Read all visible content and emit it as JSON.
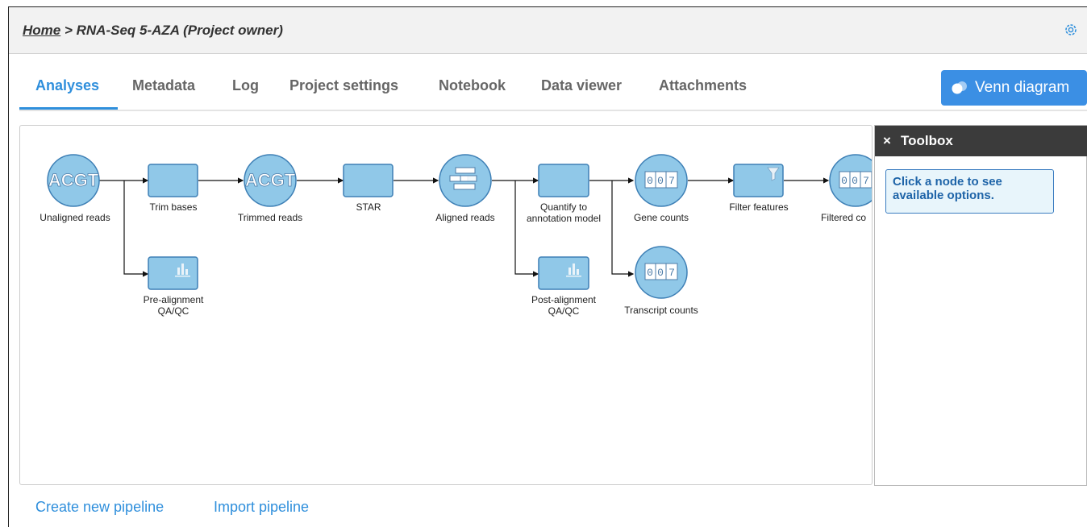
{
  "breadcrumb": {
    "home": "Home",
    "rest": " > RNA-Seq 5-AZA (Project owner)"
  },
  "tabs": [
    "Analyses",
    "Metadata",
    "Log",
    "Project settings",
    "Notebook",
    "Data viewer",
    "Attachments"
  ],
  "venn_button": {
    "label": "Venn diagram",
    "icon": "venn-icon"
  },
  "toolbox": {
    "close": "×",
    "title": "Toolbox",
    "hint": "Click a node to see available options."
  },
  "nodes": {
    "unaligned": "Unaligned reads",
    "trim": "Trim bases",
    "trimmed": "Trimmed reads",
    "star": "STAR",
    "aligned": "Aligned reads",
    "quantify1": "Quantify to",
    "quantify2": "annotation model",
    "gene_counts": "Gene counts",
    "filter": "Filter features",
    "filtered": "Filtered co",
    "pre1": "Pre-alignment",
    "pre2": "QA/QC",
    "post1": "Post-alignment",
    "post2": "QA/QC",
    "transcript": "Transcript counts"
  },
  "links": {
    "create": "Create new pipeline",
    "import": "Import pipeline"
  },
  "colors": {
    "accent": "#2f8fdc",
    "node_fill": "#90c8e8",
    "node_stroke": "#3d7fb5"
  }
}
